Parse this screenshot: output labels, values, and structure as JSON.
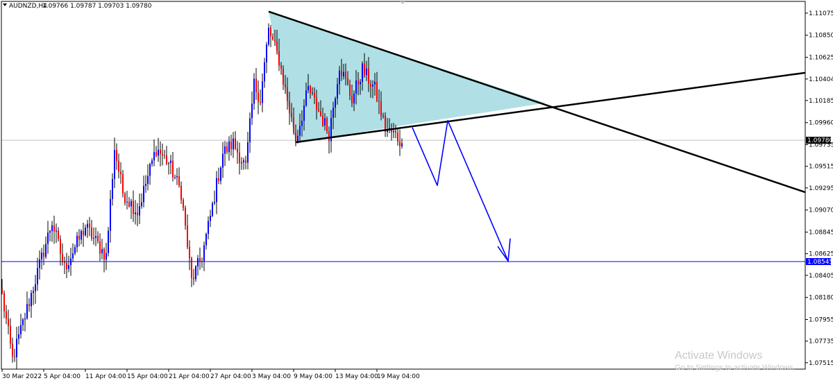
{
  "header": {
    "symbol": "AUDNZD,H4",
    "ohlc": "1.09766 1.09787 1.09703 1.09780"
  },
  "watermark": {
    "title": "Activate Windows",
    "subtitle": "Go to Settings to activate Windows."
  },
  "colors": {
    "bull": "#0000ff",
    "bear": "#ff0000",
    "wick": "#000000",
    "triangle_fill": "#b0dfe5",
    "trend_line": "#000000",
    "projection": "#0000ff",
    "support_line": "#0000ff",
    "price_line": "#c0c0c0"
  },
  "chart_data": {
    "type": "candlestick",
    "symbol": "AUDNZD",
    "timeframe": "H4",
    "ylim": [
      1.0745,
      1.1118
    ],
    "y_ticks": [
      "1.11075",
      "1.10850",
      "1.10625",
      "1.10404",
      "1.10185",
      "1.09960",
      "1.09735",
      "1.09515",
      "1.09295",
      "1.09070",
      "1.08845",
      "1.08625",
      "1.08405",
      "1.08180",
      "1.07955",
      "1.07735",
      "1.07515"
    ],
    "x_ticks": [
      "30 Mar 2022",
      "5 Apr 04:00",
      "11 Apr 04:00",
      "15 Apr 04:00",
      "21 Apr 04:00",
      "27 Apr 04:00",
      "3 May 04:00",
      "9 May 04:00",
      "13 May 04:00",
      "19 May 04:00"
    ],
    "bar_index_range": [
      0,
      196
    ],
    "x_tick_bars": [
      0,
      20,
      40,
      60,
      80,
      100,
      120,
      140,
      160,
      180
    ],
    "current_price": "1.09780",
    "support_level": "1.08545",
    "key_points": [
      {
        "bar": 0,
        "price": 1.082
      },
      {
        "bar": 5,
        "price": 1.0755
      },
      {
        "bar": 24,
        "price": 1.0895
      },
      {
        "bar": 30,
        "price": 1.0848
      },
      {
        "bar": 40,
        "price": 1.089
      },
      {
        "bar": 50,
        "price": 1.086
      },
      {
        "bar": 54,
        "price": 1.097
      },
      {
        "bar": 58,
        "price": 1.0925
      },
      {
        "bar": 65,
        "price": 1.0905
      },
      {
        "bar": 74,
        "price": 1.097
      },
      {
        "bar": 80,
        "price": 1.0955
      },
      {
        "bar": 86,
        "price": 1.0925
      },
      {
        "bar": 91,
        "price": 1.0835
      },
      {
        "bar": 96,
        "price": 1.086
      },
      {
        "bar": 100,
        "price": 1.09
      },
      {
        "bar": 106,
        "price": 1.0965
      },
      {
        "bar": 111,
        "price": 1.0975
      },
      {
        "bar": 117,
        "price": 1.095
      },
      {
        "bar": 121,
        "price": 1.1035
      },
      {
        "bar": 124,
        "price": 1.102
      },
      {
        "bar": 128,
        "price": 1.109
      },
      {
        "bar": 133,
        "price": 1.106
      },
      {
        "bar": 141,
        "price": 1.0978
      },
      {
        "bar": 147,
        "price": 1.103
      },
      {
        "bar": 152,
        "price": 1.1008
      },
      {
        "bar": 157,
        "price": 1.0985
      },
      {
        "bar": 162,
        "price": 1.1055
      },
      {
        "bar": 168,
        "price": 1.102
      },
      {
        "bar": 173,
        "price": 1.105
      },
      {
        "bar": 179,
        "price": 1.103
      },
      {
        "bar": 184,
        "price": 1.099
      },
      {
        "bar": 189,
        "price": 1.0983
      },
      {
        "bar": 192,
        "price": 1.0975
      }
    ],
    "drawings": {
      "upper_trendline": [
        {
          "bar": 128,
          "price": 1.1109
        },
        {
          "bar": 390,
          "price": 1.0922
        }
      ],
      "lower_trendline": [
        {
          "bar": 141,
          "price": 1.0976
        },
        {
          "bar": 390,
          "price": 1.1048
        }
      ],
      "triangle": [
        {
          "bar": 128,
          "price": 1.1109
        },
        {
          "bar": 141,
          "price": 1.0976
        },
        {
          "bar": 261,
          "price": 1.1016
        }
      ],
      "projection_path": [
        {
          "bar": 197,
          "price": 1.0991
        },
        {
          "bar": 209,
          "price": 1.0932
        },
        {
          "bar": 214,
          "price": 1.0998
        },
        {
          "bar": 243,
          "price": 1.0855
        }
      ],
      "projection_arrow": [
        {
          "bar": 238,
          "price": 1.087
        },
        {
          "bar": 243,
          "price": 1.0855
        },
        {
          "bar": 244,
          "price": 1.0878
        }
      ]
    }
  }
}
